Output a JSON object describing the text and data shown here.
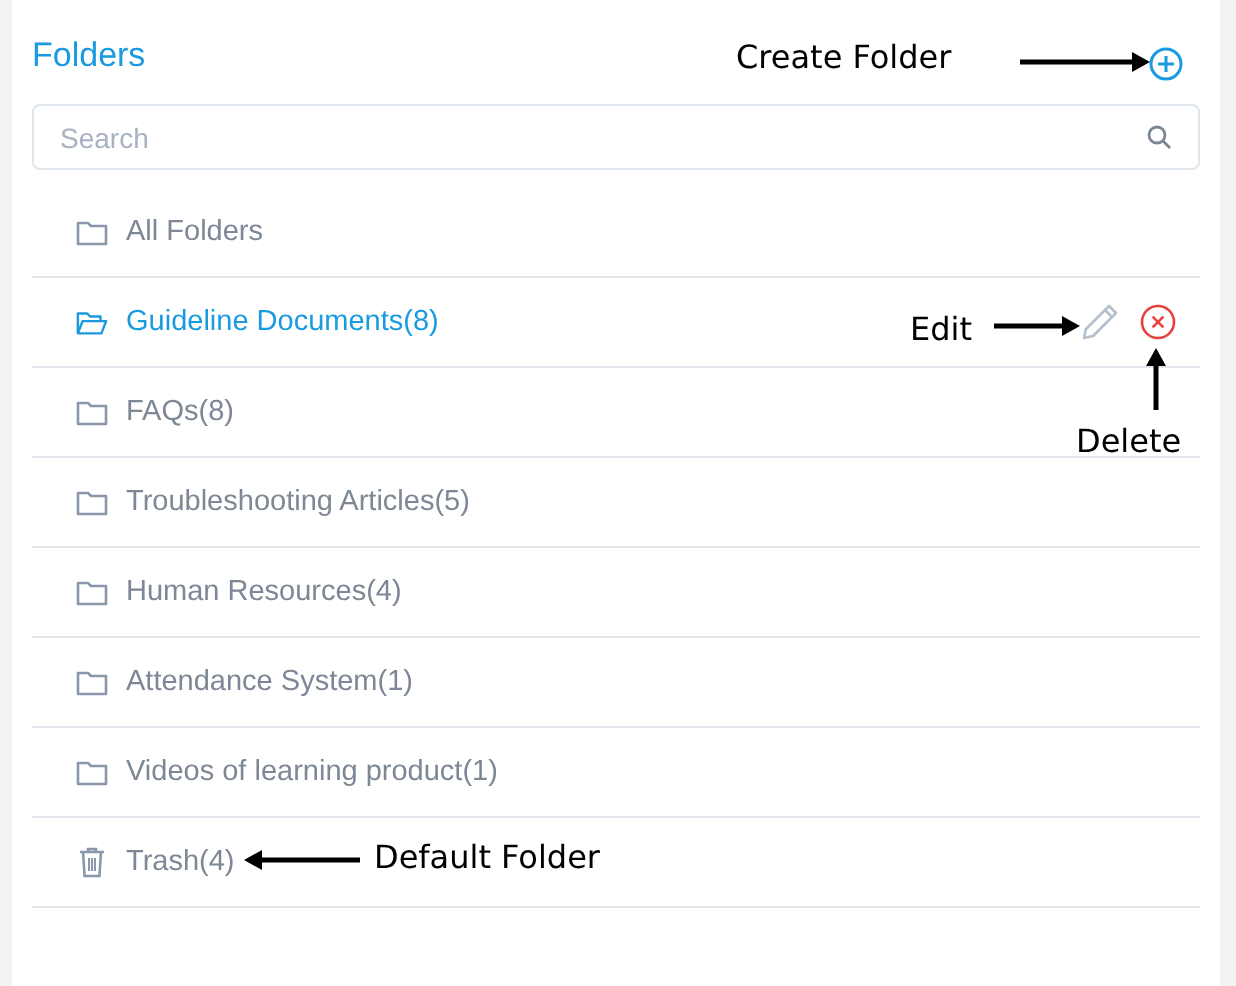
{
  "title": "Folders",
  "search": {
    "placeholder": "Search"
  },
  "folders": [
    {
      "kind": "folder",
      "label": "All Folders",
      "selected": false
    },
    {
      "kind": "folder",
      "label": "Guideline Documents(8)",
      "selected": true
    },
    {
      "kind": "folder",
      "label": "FAQs(8)",
      "selected": false
    },
    {
      "kind": "folder",
      "label": "Troubleshooting Articles(5)",
      "selected": false
    },
    {
      "kind": "folder",
      "label": "Human Resources(4)",
      "selected": false
    },
    {
      "kind": "folder",
      "label": "Attendance System(1)",
      "selected": false
    },
    {
      "kind": "folder",
      "label": "Videos of learning product(1)",
      "selected": false
    },
    {
      "kind": "trash",
      "label": "Trash(4)",
      "selected": false
    }
  ],
  "annotations": [
    {
      "kind": "create",
      "text": "Create Folder"
    },
    {
      "kind": "edit",
      "text": "Edit"
    },
    {
      "kind": "delete",
      "text": "Delete"
    },
    {
      "kind": "default",
      "text": "Default Folder"
    }
  ]
}
